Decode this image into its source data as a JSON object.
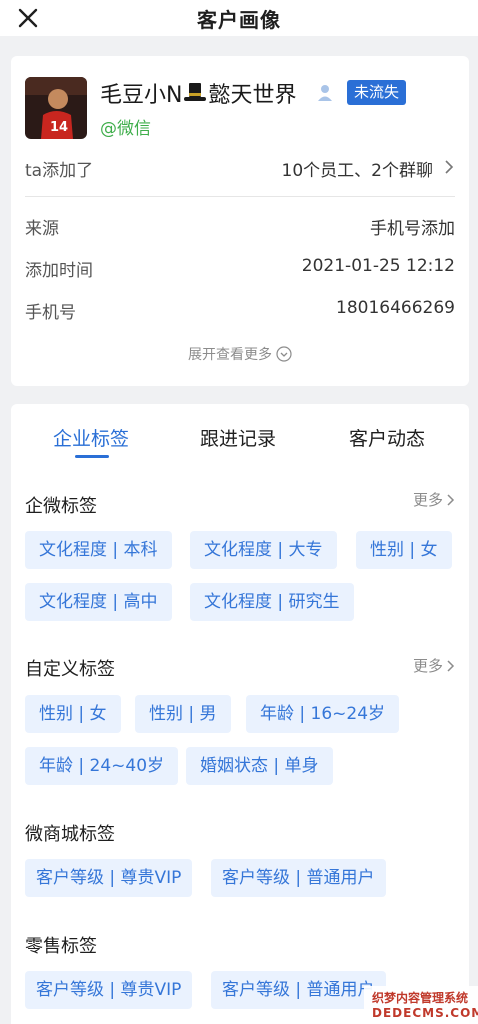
{
  "nav": {
    "title": "客户画像"
  },
  "profile": {
    "name_prefix": "毛豆小N",
    "name_suffix": "懿天世界",
    "status": "未流失",
    "source_platform": "@微信",
    "added_label": "ta添加了",
    "added_value": "10个员工、2个群聊",
    "info": [
      {
        "label": "来源",
        "value": "手机号添加"
      },
      {
        "label": "添加时间",
        "value": "2021-01-25 12:12"
      },
      {
        "label": "手机号",
        "value": "18016466269"
      }
    ],
    "expand_label": "展开查看更多"
  },
  "tabs": [
    "企业标签",
    "跟进记录",
    "客户动态"
  ],
  "active_tab": "企业标签",
  "more_label": "更多",
  "sections": [
    {
      "title": "企微标签",
      "tags": [
        "文化程度 | 本科",
        "文化程度 | 大专",
        "性别 | 女",
        "文化程度 | 高中",
        "文化程度 | 研究生"
      ]
    },
    {
      "title": "自定义标签",
      "tags": [
        "性别 | 女",
        "性别 | 男",
        "年龄 | 16~24岁",
        "年龄 | 24~40岁",
        "婚姻状态 | 单身"
      ]
    },
    {
      "title": "微商城标签",
      "tags": [
        "客户等级 | 尊贵VIP",
        "客户等级 | 普通用户"
      ]
    },
    {
      "title": "零售标签",
      "tags": [
        "客户等级 | 尊贵VIP",
        "客户等级 | 普通用户"
      ]
    }
  ],
  "watermark": {
    "line1": "织梦内容管理系统",
    "line2": "DEDECMS.COM"
  },
  "colors": {
    "accent": "#2a6fd6",
    "tag_bg": "#eaf2fe",
    "wechat_green": "#3fae4b"
  }
}
